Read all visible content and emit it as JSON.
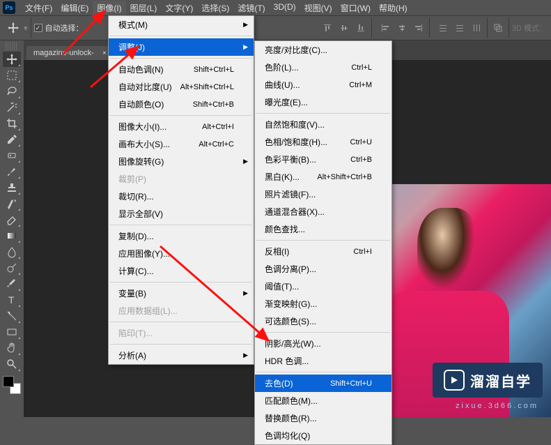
{
  "menubar": {
    "items": [
      "文件(F)",
      "编辑(E)",
      "图像(I)",
      "图层(L)",
      "文字(Y)",
      "选择(S)",
      "滤镜(T)",
      "3D(D)",
      "视图(V)",
      "窗口(W)",
      "帮助(H)"
    ],
    "active_index": 2
  },
  "optionsbar": {
    "auto_select_label": "自动选择：",
    "mode3d_label": "3D 模式："
  },
  "doctab": {
    "name": "magazine-unlock-",
    "close": "×"
  },
  "dropdown1": {
    "groups": [
      [
        {
          "label": "模式(M)",
          "arrow": true
        }
      ],
      [
        {
          "label": "调整(J)",
          "arrow": true,
          "hover": true
        }
      ],
      [
        {
          "label": "自动色调(N)",
          "short": "Shift+Ctrl+L"
        },
        {
          "label": "自动对比度(U)",
          "short": "Alt+Shift+Ctrl+L"
        },
        {
          "label": "自动颜色(O)",
          "short": "Shift+Ctrl+B"
        }
      ],
      [
        {
          "label": "图像大小(I)...",
          "short": "Alt+Ctrl+I"
        },
        {
          "label": "画布大小(S)...",
          "short": "Alt+Ctrl+C"
        },
        {
          "label": "图像旋转(G)",
          "arrow": true
        },
        {
          "label": "裁剪(P)",
          "disabled": true
        },
        {
          "label": "裁切(R)..."
        },
        {
          "label": "显示全部(V)"
        }
      ],
      [
        {
          "label": "复制(D)..."
        },
        {
          "label": "应用图像(Y)..."
        },
        {
          "label": "计算(C)..."
        }
      ],
      [
        {
          "label": "变量(B)",
          "arrow": true
        },
        {
          "label": "应用数据组(L)...",
          "disabled": true
        }
      ],
      [
        {
          "label": "陷印(T)...",
          "disabled": true
        }
      ],
      [
        {
          "label": "分析(A)",
          "arrow": true
        }
      ]
    ]
  },
  "dropdown2": {
    "groups": [
      [
        {
          "label": "亮度/对比度(C)..."
        },
        {
          "label": "色阶(L)...",
          "short": "Ctrl+L"
        },
        {
          "label": "曲线(U)...",
          "short": "Ctrl+M"
        },
        {
          "label": "曝光度(E)..."
        }
      ],
      [
        {
          "label": "自然饱和度(V)..."
        },
        {
          "label": "色相/饱和度(H)...",
          "short": "Ctrl+U"
        },
        {
          "label": "色彩平衡(B)...",
          "short": "Ctrl+B"
        },
        {
          "label": "黑白(K)...",
          "short": "Alt+Shift+Ctrl+B"
        },
        {
          "label": "照片滤镜(F)..."
        },
        {
          "label": "通道混合器(X)..."
        },
        {
          "label": "颜色查找..."
        }
      ],
      [
        {
          "label": "反相(I)",
          "short": "Ctrl+I"
        },
        {
          "label": "色调分离(P)..."
        },
        {
          "label": "阈值(T)..."
        },
        {
          "label": "渐变映射(G)..."
        },
        {
          "label": "可选颜色(S)..."
        }
      ],
      [
        {
          "label": "阴影/高光(W)..."
        },
        {
          "label": "HDR 色调..."
        }
      ],
      [
        {
          "label": "去色(D)",
          "short": "Shift+Ctrl+U",
          "hover": true
        },
        {
          "label": "匹配颜色(M)..."
        },
        {
          "label": "替换颜色(R)..."
        },
        {
          "label": "色调均化(Q)"
        }
      ]
    ]
  },
  "brand": {
    "text": "溜溜自学",
    "sub": "zixue.3d66.com"
  },
  "tools": [
    "move",
    "marquee",
    "lasso",
    "wand",
    "crop",
    "eyedrop",
    "patch",
    "brush",
    "stamp",
    "history",
    "eraser",
    "gradient",
    "blur",
    "dodge",
    "pen",
    "type",
    "path",
    "rect",
    "hand",
    "zoom"
  ]
}
